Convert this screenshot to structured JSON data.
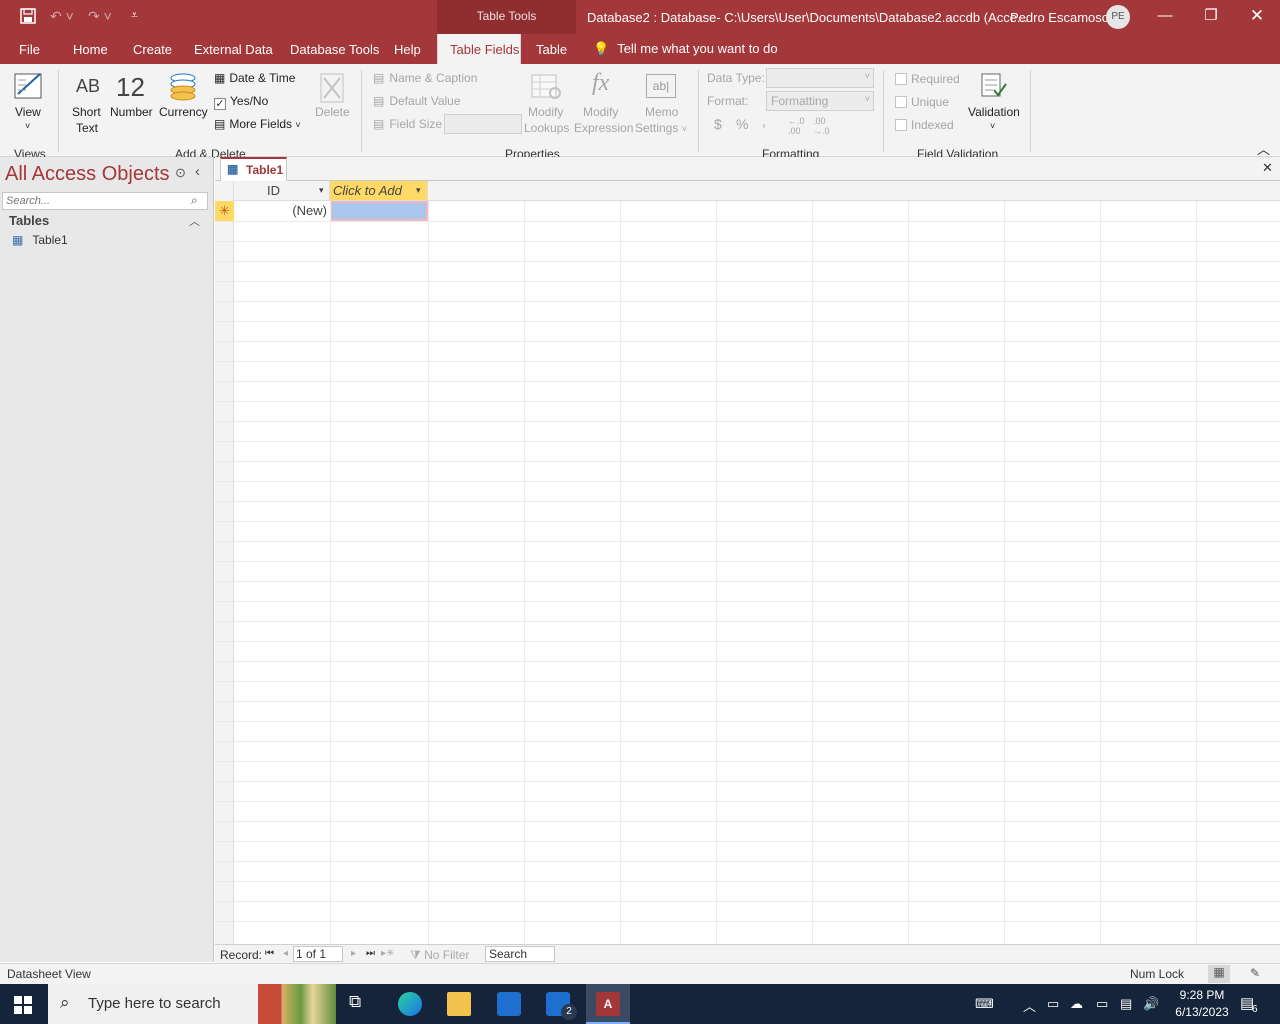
{
  "titlebar": {
    "context_label": "Table Tools",
    "window_title": "Database2 : Database- C:\\Users\\User\\Documents\\Database2.accdb (Acce...",
    "user_name": "Pedro Escamoso",
    "user_initials": "PE"
  },
  "tabs": {
    "file": "File",
    "home": "Home",
    "create": "Create",
    "external_data": "External Data",
    "database_tools": "Database Tools",
    "help": "Help",
    "table_fields": "Table Fields",
    "table": "Table",
    "tell_me": "Tell me what you want to do"
  },
  "ribbon": {
    "view": "View",
    "views_group": "Views",
    "short_text_glyph": "AB",
    "short_text_1": "Short",
    "short_text_2": "Text",
    "number_glyph": "12",
    "number": "Number",
    "currency": "Currency",
    "date_time": "Date & Time",
    "yes_no": "Yes/No",
    "more_fields": "More Fields",
    "delete": "Delete",
    "add_delete_group": "Add & Delete",
    "name_caption": "Name & Caption",
    "default_value": "Default Value",
    "field_size": "Field Size",
    "modify_lookups_1": "Modify",
    "modify_lookups_2": "Lookups",
    "modify_expression_1": "Modify",
    "modify_expression_2": "Expression",
    "memo_settings_1": "Memo",
    "memo_settings_2": "Settings",
    "properties_group": "Properties",
    "data_type_label": "Data Type:",
    "format_label": "Format:",
    "format_value": "Formatting",
    "currency_symbol": "$",
    "percent_symbol": "%",
    "comma_symbol": ",",
    "formatting_group": "Formatting",
    "required": "Required",
    "unique": "Unique",
    "indexed": "Indexed",
    "validation": "Validation",
    "field_validation_group": "Field Validation",
    "yes_no_checked": true
  },
  "nav": {
    "title": "All Access Objects",
    "search_placeholder": "Search...",
    "section": "Tables",
    "items": [
      "Table1"
    ]
  },
  "document": {
    "tab_label": "Table1",
    "columns": [
      "ID",
      "Click to Add"
    ],
    "new_row_id": "(New)"
  },
  "record_nav": {
    "label": "Record:",
    "position": "1 of 1",
    "filter": "No Filter",
    "search": "Search"
  },
  "status": {
    "view_name": "Datasheet View",
    "num_lock": "Num Lock"
  },
  "taskbar": {
    "search_placeholder": "Type here to search",
    "mail_badge": "2",
    "time": "9:28 PM",
    "date": "6/13/2023",
    "notification_count": "6"
  },
  "colors": {
    "access_red": "#a4373a",
    "ribbon_bg": "#f3f3f3",
    "header_highlight": "#ffd966",
    "selected_cell": "#a9c7ec",
    "taskbar_bg": "#15243a"
  }
}
